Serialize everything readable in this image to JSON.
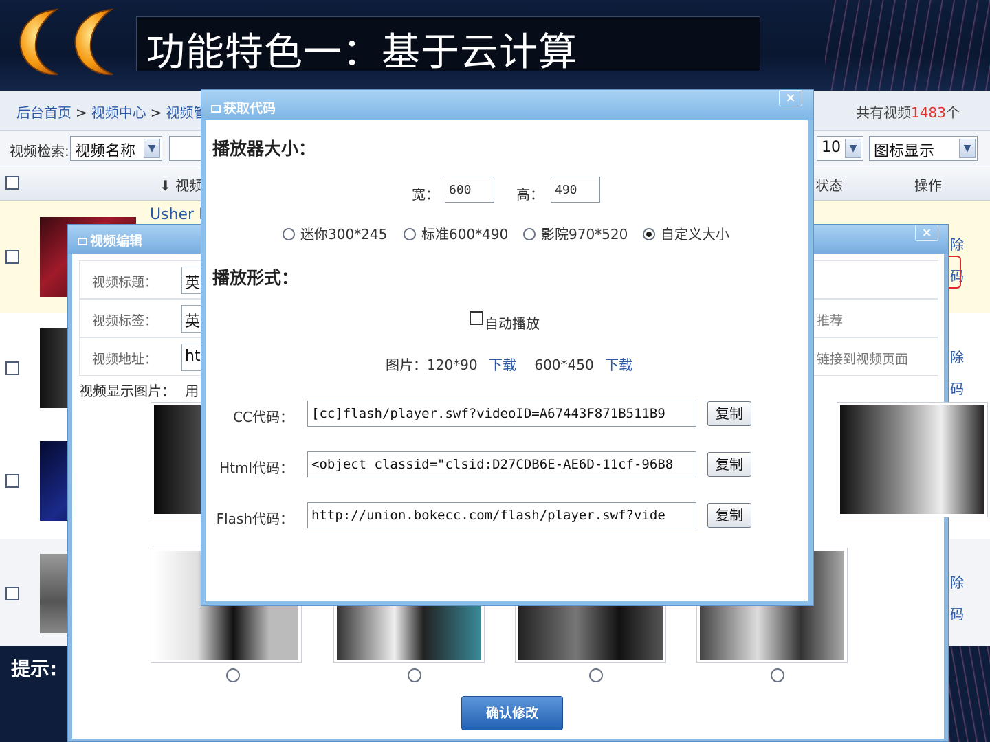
{
  "slide": {
    "title": "功能特色一：基于云计算",
    "tip_label": "提示:"
  },
  "admin": {
    "breadcrumb": [
      "后台首页",
      "视频中心",
      "视频管"
    ],
    "count_prefix": "共有视频",
    "count_value": "1483",
    "count_suffix": "个",
    "search_label": "视频检索:",
    "search_field": "视频名称",
    "per_page": "10",
    "display_mode": "图标显示",
    "col_video": "⬇ 视频",
    "col_status": "状态",
    "col_ops": "操作",
    "row1_title": "Usher D",
    "op_delete": "除",
    "op_code": "码"
  },
  "edit_modal": {
    "title": "视频编辑",
    "fields": [
      {
        "label": "视频标题：",
        "value": "英"
      },
      {
        "label": "视频标签：",
        "value": "英",
        "extra": "推荐"
      },
      {
        "label": "视频地址：",
        "value": "ht",
        "extra": "链接到视频页面"
      }
    ],
    "image_label": "视频显示图片：",
    "image_label_tail": "用",
    "confirm": "确认修改"
  },
  "code_modal": {
    "title": "获取代码",
    "close": "×",
    "player_size_title": "播放器大小：",
    "width_label": "宽：",
    "width_value": "600",
    "height_label": "高：",
    "height_value": "490",
    "size_options": [
      {
        "label": "迷你300*245",
        "checked": false
      },
      {
        "label": "标准600*490",
        "checked": false
      },
      {
        "label": "影院970*520",
        "checked": false
      },
      {
        "label": "自定义大小",
        "checked": true
      }
    ],
    "play_mode_title": "播放形式：",
    "autoplay_label": "自动播放",
    "autoplay_checked": false,
    "image_prefix": "图片：120*90",
    "download1": "下载",
    "image_large": "600*450",
    "download2": "下载",
    "codes": [
      {
        "label": "CC代码：",
        "value": "[cc]flash/player.swf?videoID=A67443F871B511B9"
      },
      {
        "label": "Html代码：",
        "value": "<object classid=\"clsid:D27CDB6E-AE6D-11cf-96B8"
      },
      {
        "label": "Flash代码：",
        "value": "http://union.bokecc.com/flash/player.swf?vide"
      }
    ],
    "copy_label": "复制"
  },
  "colors": {
    "accent_red": "#e02a2a",
    "link_blue": "#2a5aa8",
    "modal_blue": "#8cc0ea"
  }
}
